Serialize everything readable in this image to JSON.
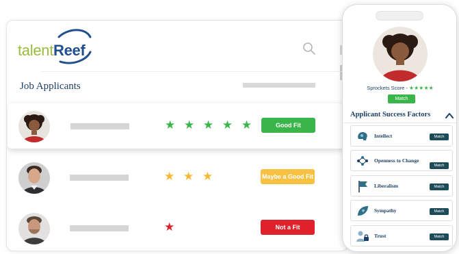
{
  "brand": {
    "logo_part1": "talent",
    "logo_part2": "Reef"
  },
  "header": {
    "title": "Job Applicants"
  },
  "applicants": [
    {
      "stars": "★ ★ ★ ★ ★",
      "star_color": "#39b54a",
      "fit_label": "Good Fit",
      "fit_color": "#39b54a",
      "rating": 5
    },
    {
      "stars": "★ ★ ★",
      "star_color": "#f7b932",
      "fit_label": "Maybe a Good Fit",
      "fit_color": "#f7c244",
      "rating": 3
    },
    {
      "stars": "★",
      "star_color": "#d9232e",
      "fit_label": "Not a Fit",
      "fit_color": "#e0212b",
      "rating": 1
    }
  ],
  "profile": {
    "score_label": "Sprockets Score - ",
    "score_stars": "★★★★★",
    "match_label": "Match",
    "section_title": "Applicant Success Factors",
    "factors": [
      {
        "label": "Intellect",
        "match": "Match",
        "icon": "brain-icon"
      },
      {
        "label": "Openness to Change",
        "match": "Match",
        "icon": "nodes-icon"
      },
      {
        "label": "Liberalism",
        "match": "Match",
        "icon": "flag-icon"
      },
      {
        "label": "Sympathy",
        "match": "Match",
        "icon": "heart-leaf-icon"
      },
      {
        "label": "Trust",
        "match": "Match",
        "icon": "lock-person-icon"
      }
    ]
  },
  "colors": {
    "navy": "#1d3f63",
    "green": "#39b54a",
    "teal_button": "#1e4b58"
  }
}
